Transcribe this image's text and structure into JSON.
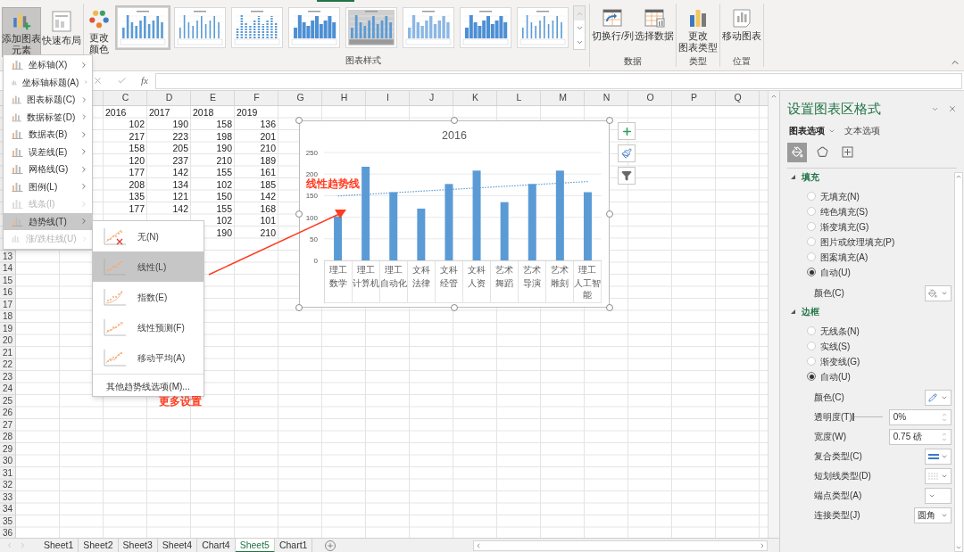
{
  "ribbon": {
    "layout_buttons": [
      {
        "lines": [
          "添加图表",
          "元素"
        ],
        "kind": "add-element",
        "selected": true
      },
      {
        "lines": [
          "快速布局"
        ],
        "kind": "quick-layout",
        "selected": false
      }
    ],
    "change_colors": {
      "lines": [
        "更改",
        "颜色"
      ],
      "kind": "change-colors",
      "selected": false
    },
    "chart_styles": {
      "label": "图表样式",
      "thumbnails": [
        {
          "kind": "plain",
          "selected": true
        },
        {
          "kind": "thin",
          "selected": false
        },
        {
          "kind": "dotted",
          "selected": false
        },
        {
          "kind": "solid",
          "selected": false
        },
        {
          "kind": "shaded",
          "selected": false
        },
        {
          "kind": "light",
          "selected": false
        },
        {
          "kind": "solid",
          "selected": false
        },
        {
          "kind": "thin",
          "selected": false
        }
      ]
    },
    "groups": [
      {
        "label": "数据",
        "buttons": [
          {
            "lines": [
              "切换行/列"
            ],
            "kind": "switch"
          },
          {
            "lines": [
              "选择数据"
            ],
            "kind": "select-data"
          }
        ]
      },
      {
        "label": "类型",
        "buttons": [
          {
            "lines": [
              "更改",
              "图表类型"
            ],
            "kind": "change-type"
          }
        ]
      },
      {
        "label": "位置",
        "buttons": [
          {
            "lines": [
              "移动图表"
            ],
            "kind": "move-chart"
          }
        ]
      }
    ]
  },
  "formula_bar": {
    "function_label": "fx"
  },
  "grid": {
    "columns": [
      "C",
      "D",
      "E",
      "F",
      "G",
      "H",
      "I",
      "J",
      "K",
      "L",
      "M",
      "N",
      "O",
      "P",
      "Q"
    ],
    "row_numbers": [
      "13",
      "14",
      "15",
      "16",
      "17",
      "18",
      "19",
      "20",
      "21",
      "22",
      "23",
      "24",
      "25",
      "26",
      "27",
      "28",
      "29",
      "30",
      "31",
      "32",
      "33",
      "34",
      "35",
      "36"
    ],
    "rows": [
      {
        "kind": "text",
        "cells": [
          "2016",
          "2017",
          "2018",
          "2019"
        ]
      },
      {
        "kind": "number",
        "cells": [
          "102",
          "190",
          "158",
          "136"
        ]
      },
      {
        "kind": "number",
        "cells": [
          "217",
          "223",
          "198",
          "201"
        ]
      },
      {
        "kind": "number",
        "cells": [
          "158",
          "205",
          "190",
          "210"
        ]
      },
      {
        "kind": "number",
        "cells": [
          "120",
          "237",
          "210",
          "189"
        ]
      },
      {
        "kind": "number",
        "cells": [
          "177",
          "142",
          "155",
          "161"
        ]
      },
      {
        "kind": "number",
        "cells": [
          "208",
          "134",
          "102",
          "185"
        ]
      },
      {
        "kind": "number",
        "cells": [
          "135",
          "121",
          "150",
          "142"
        ]
      },
      {
        "kind": "number",
        "cells": [
          "177",
          "142",
          "155",
          "168"
        ]
      },
      {
        "kind": "number",
        "cells": [
          null,
          null,
          "102",
          "101"
        ]
      },
      {
        "kind": "number",
        "cells": [
          null,
          null,
          "190",
          "210"
        ]
      }
    ]
  },
  "chart": {
    "trendline": {
      "kind": "linear"
    },
    "category_groups": [
      "理工",
      "理工",
      "理工",
      "文科",
      "文科",
      "文科",
      "艺术",
      "艺术",
      "艺术",
      "理工"
    ],
    "chart_data": {
      "type": "bar",
      "title": "2016",
      "categories": [
        "数学",
        "计算机",
        "自动化",
        "法律",
        "经管",
        "人资",
        "舞蹈",
        "导演",
        "雕刻",
        "人工智能"
      ],
      "series": [
        {
          "color": "#5b9bd5",
          "values": [
            102,
            217,
            158,
            120,
            177,
            208,
            135,
            177,
            208,
            158
          ]
        }
      ],
      "ylim": [
        0,
        250
      ],
      "yticks": [
        0,
        50,
        100,
        150,
        200,
        250
      ],
      "grid": true
    }
  },
  "chart_menu": {
    "items": [
      {
        "label": "坐标轴(X)",
        "disabled": false,
        "selected": false
      },
      {
        "label": "坐标轴标题(A)",
        "disabled": false,
        "selected": false
      },
      {
        "label": "图表标题(C)",
        "disabled": false,
        "selected": false
      },
      {
        "label": "数据标签(D)",
        "disabled": false,
        "selected": false
      },
      {
        "label": "数据表(B)",
        "disabled": false,
        "selected": false
      },
      {
        "label": "误差线(E)",
        "disabled": false,
        "selected": false
      },
      {
        "label": "网格线(G)",
        "disabled": false,
        "selected": false
      },
      {
        "label": "图例(L)",
        "disabled": false,
        "selected": false
      },
      {
        "label": "线条(I)",
        "disabled": true,
        "selected": false
      },
      {
        "label": "趋势线(T)",
        "disabled": false,
        "selected": true
      },
      {
        "label": "涨/跌柱线(U)",
        "disabled": true,
        "selected": false
      }
    ]
  },
  "trendline_menu": {
    "items": [
      {
        "label": "无(N)",
        "kind": "none",
        "selected": false
      },
      {
        "label": "线性(L)",
        "kind": "linear",
        "selected": true
      },
      {
        "label": "指数(E)",
        "kind": "exponential",
        "selected": false
      },
      {
        "label": "线性预测(F)",
        "kind": "forecast",
        "selected": false
      },
      {
        "label": "移动平均(A)",
        "kind": "moving-average",
        "selected": false
      }
    ],
    "more": "其他趋势线选项(M)..."
  },
  "annotations": [
    {
      "text": "线性趋势线",
      "kind": "chart-note"
    },
    {
      "text": "更多设置",
      "kind": "menu-note"
    }
  ],
  "format_pane": {
    "title": "设置图表区格式",
    "tabs": [
      {
        "label": "图表选项",
        "selected": true
      },
      {
        "label": "文本选项",
        "selected": false
      }
    ],
    "icon_tabs": [
      {
        "kind": "fill",
        "selected": true
      },
      {
        "kind": "effects",
        "selected": false
      },
      {
        "kind": "size",
        "selected": false
      }
    ],
    "sections": [
      {
        "title": "填充",
        "expanded": true,
        "options": [
          {
            "label": "无填充(N)",
            "selected": false
          },
          {
            "label": "纯色填充(S)",
            "selected": false
          },
          {
            "label": "渐变填充(G)",
            "selected": false
          },
          {
            "label": "图片或纹理填充(P)",
            "selected": false
          },
          {
            "label": "图案填充(A)",
            "selected": false
          },
          {
            "label": "自动(U)",
            "selected": true
          }
        ],
        "rows": [
          {
            "kind": "fill-color",
            "label": "颜色(C)"
          }
        ]
      },
      {
        "title": "边框",
        "expanded": true,
        "options": [
          {
            "label": "无线条(N)",
            "selected": false
          },
          {
            "label": "实线(S)",
            "selected": false
          },
          {
            "label": "渐变线(G)",
            "selected": false
          },
          {
            "label": "自动(U)",
            "selected": true
          }
        ],
        "rows": [
          {
            "kind": "line-color",
            "label": "颜色(C)"
          },
          {
            "kind": "slider",
            "label": "透明度(T)",
            "level": 0,
            "value": "0%"
          },
          {
            "kind": "spin",
            "label": "宽度(W)",
            "value": "0.75 磅"
          },
          {
            "kind": "compound",
            "label": "复合类型(C)"
          },
          {
            "kind": "dash",
            "label": "短划线类型(D)"
          },
          {
            "kind": "cap",
            "label": "端点类型(A)"
          },
          {
            "kind": "select",
            "label": "连接类型(J)",
            "value": "圆角"
          }
        ]
      }
    ]
  },
  "sheet_tabs": [
    {
      "label": "Sheet1",
      "selected": false
    },
    {
      "label": "Sheet2",
      "selected": false
    },
    {
      "label": "Sheet3",
      "selected": false
    },
    {
      "label": "Sheet4",
      "selected": false
    },
    {
      "label": "Chart4",
      "selected": false
    },
    {
      "label": "Sheet5",
      "selected": true
    },
    {
      "label": "Chart1",
      "selected": false
    }
  ]
}
